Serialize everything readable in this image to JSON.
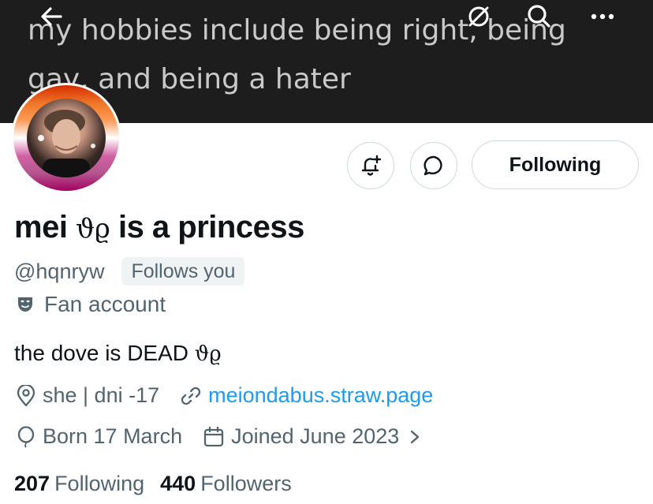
{
  "banner": {
    "text": "my hobbies include being right, being gay, and being a hater"
  },
  "nav": {
    "icons": [
      "arrow-left-icon",
      "decrypt-icon",
      "search-icon",
      "more-icon"
    ]
  },
  "actions": {
    "following_label": "Following"
  },
  "profile": {
    "name_part1": "mei ",
    "name_symbols": "ϑϱ",
    "name_part2": " is a princess",
    "handle": "@hqnryw",
    "follows_you": "Follows you",
    "category": "Fan account",
    "bio_text": "the dove is DEAD ",
    "bio_symbols": "ϑϱ",
    "pronouns": "she | dni -17",
    "website": "meiondabus.straw.page",
    "birthday": "Born 17 March",
    "joined": "Joined June 2023"
  },
  "stats": {
    "following_count": "207",
    "following_label": "Following",
    "followers_count": "440",
    "followers_label": "Followers"
  },
  "colors": {
    "link": "#1d9bf0",
    "secondary_text": "#536471",
    "border": "#cfd9de"
  }
}
